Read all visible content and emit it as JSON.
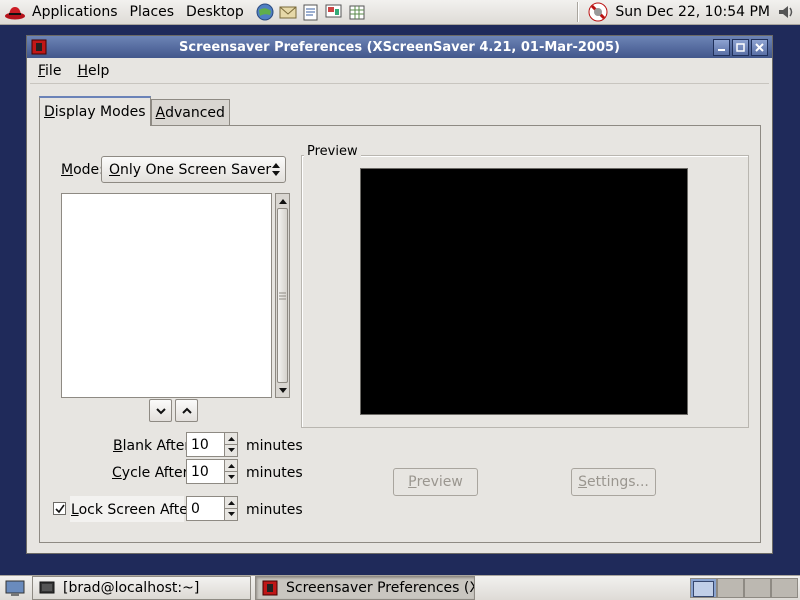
{
  "top_panel": {
    "menus": [
      "Applications",
      "Places",
      "Desktop"
    ],
    "launchers": [
      "web-browser-icon",
      "email-icon",
      "office-writer-icon",
      "office-impress-icon",
      "office-calc-icon"
    ],
    "clock": "Sun Dec 22, 10:54 PM"
  },
  "window": {
    "title": "Screensaver Preferences  (XScreenSaver 4.21, 01-Mar-2005)",
    "menubar": {
      "file_mnemonic": "F",
      "file_rest": "ile",
      "help_mnemonic": "H",
      "help_rest": "elp"
    }
  },
  "tabs": {
    "display_modes": {
      "mnemonic": "D",
      "rest": "isplay Modes"
    },
    "advanced": {
      "mnemonic": "A",
      "rest": "dvanced"
    }
  },
  "display_modes": {
    "mode_label": {
      "mnemonic": "M",
      "rest": "ode:"
    },
    "mode_value": {
      "mnemonic": "O",
      "rest": "nly One Screen Saver"
    },
    "blank_after": {
      "mnemonic": "B",
      "rest": "lank After",
      "value": "10",
      "unit": "minutes"
    },
    "cycle_after": {
      "mnemonic": "C",
      "rest": "ycle After",
      "value": "10",
      "unit": "minutes"
    },
    "lock_screen": {
      "mnemonic": "L",
      "rest": "ock Screen After",
      "checked": true,
      "value": "0",
      "unit": "minutes"
    },
    "preview_legend": "Preview",
    "preview_button": {
      "mnemonic": "P",
      "rest": "review"
    },
    "settings_button": {
      "mnemonic": "S",
      "rest": "ettings..."
    }
  },
  "taskbar": {
    "tasks": [
      "[brad@localhost:~]",
      "Screensaver Preferences  (X…"
    ]
  }
}
